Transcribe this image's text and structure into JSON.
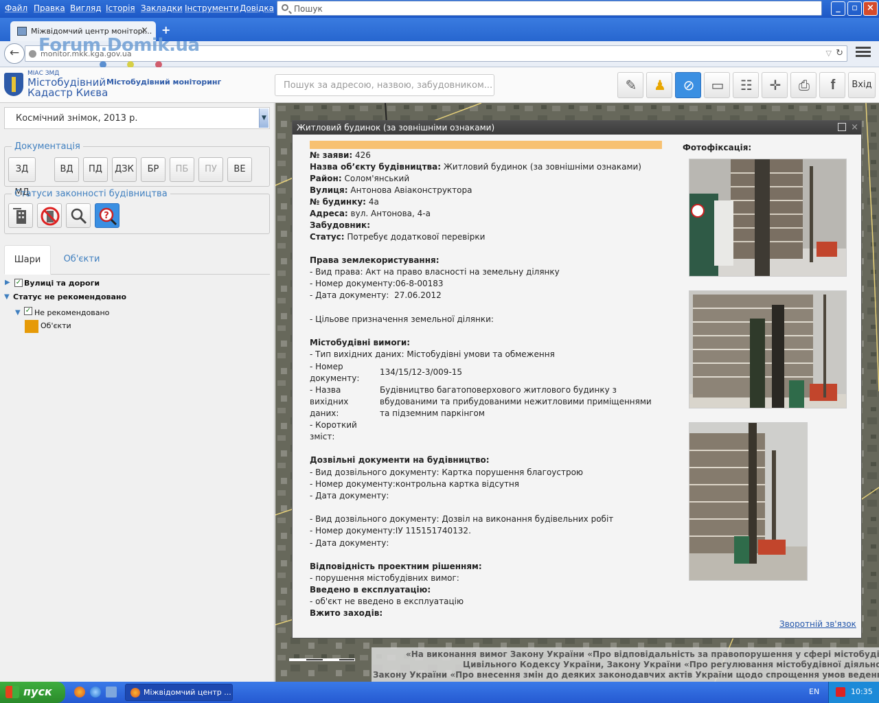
{
  "browser": {
    "menu": [
      "Файл",
      "Правка",
      "Вигляд",
      "Історія",
      "Закладки",
      "Інструменти",
      "Довідка"
    ],
    "search_placeholder": "Пошук",
    "tab_title": "Міжвідомчий центр моніторі...",
    "url": "monitor.mkk.kga.gov.ua",
    "watermark": "Forum.Domik.ua"
  },
  "app": {
    "logo_small": "МІАС ЗМД",
    "logo_line1": "Містобудівний",
    "logo_line2": "Кадастр Києва",
    "logo_subtitle": "Містобудівний моніторинг",
    "search_placeholder": "Пошук за адресою, назвою, забудовником...",
    "exit_label": "Вхід",
    "tools": [
      "edit-icon",
      "street-view-icon",
      "compass-icon",
      "ruler-icon",
      "layers-tree-icon",
      "crosshair-icon",
      "print-icon",
      "facebook-icon"
    ]
  },
  "left": {
    "basemap": "Космічний знімок, 2013 р.",
    "doc_legend": "Документація",
    "doc_buttons": [
      "ЗД МД",
      "ВД",
      "ПД",
      "ДЗК",
      "БР",
      "ПБ",
      "ПУ",
      "ВЕ"
    ],
    "status_legend": "Статуси законності будівництва",
    "tabs": [
      "Шари",
      "Об'єкти"
    ],
    "tree": {
      "streets": "Вулиці та дороги",
      "status_group": "Статус не рекомендовано",
      "not_recommended": "Не рекомендовано",
      "objects": "Об'єкти"
    },
    "swatch_color": "#e69a07"
  },
  "popup": {
    "title": "Житловий будинок (за зовнішніми ознаками)",
    "photo_label": "Фотофіксація:",
    "feedback": "Зворотній зв'язок",
    "f1k": "№ заяви:",
    "f1v": "426",
    "f2k": "Назва об’єкту будівництва:",
    "f2v": "Житловий будинок (за зовнішніми ознаками)",
    "f3k": "Район:",
    "f3v": "Солом'янський",
    "f4k": "Вулиця:",
    "f4v": "Антонова Авіаконструктора",
    "f5k": "№ будинку:",
    "f5v": "4а",
    "f6k": "Адреса:",
    "f6v": "вул. Антонова, 4-а",
    "f7k": "Забудовник:",
    "f8k": "Статус:",
    "f8v": "Потребує додаткової перевірки",
    "land_h": "Права землекористування:",
    "land_1": "- Вид права: Акт на право власності на земельну ділянку",
    "land_2": "- Номер документу:06-8-00183",
    "land_3": "- Дата документу:  27.06.2012",
    "land_4": "- Цільове призначення земельної ділянки:",
    "req_h": "Містобудівні вимоги:",
    "req_1": "- Тип вихідних даних: Містобудівні умови та обмеження",
    "req_2a": "- Номер",
    "req_2b": "документу:",
    "req_2v": "134/15/12-3/009-15",
    "req_3a": "- Назва",
    "req_3b": "вихідних",
    "req_3c": "даних:",
    "req_3v1": "Будівництво багатоповерхового житлового будинку з",
    "req_3v2": "вбудованими та прибудованими нежитловими приміщеннями",
    "req_3v3": "та підземним паркінгом",
    "req_4a": "- Короткий",
    "req_4b": "зміст:",
    "perm_h": "Дозвільні документи на будівництво:",
    "perm_1": "- Вид дозвільного документу: Картка порушення благоустрою",
    "perm_2": "- Номер документу:контрольна картка відсутня",
    "perm_3": "- Дата документу:",
    "perm_4": "- Вид дозвільного документу: Дозвіл на виконання будівельних робіт",
    "perm_5": "- Номер документу:ІУ 115151740132.",
    "perm_6": "- Дата документу:",
    "comp_h": "Відповідність проектним рішенням:",
    "comp_1": "- порушення містобудівних вимог:",
    "exp_h": "Введено в експлуатацію:",
    "exp_1": "- об'єкт не введено в експлуатацію",
    "meas_h": "Вжито заходів:"
  },
  "ticker": [
    "«На виконання вимог Закону України «Про відповідальність за правопорушення у сфері містобудівної д",
    "Цивільного Кодексу України, Закону України «Про регулювання містобудівної діяльності»,",
    "Закону України «Про внесення змін до деяких законодавчих актів України щодо спрощення умов ведення біз"
  ],
  "taskbar": {
    "start": "пуск",
    "task_item": "Міжвідомчий центр ...",
    "lang": "EN",
    "clock": "10:35"
  }
}
